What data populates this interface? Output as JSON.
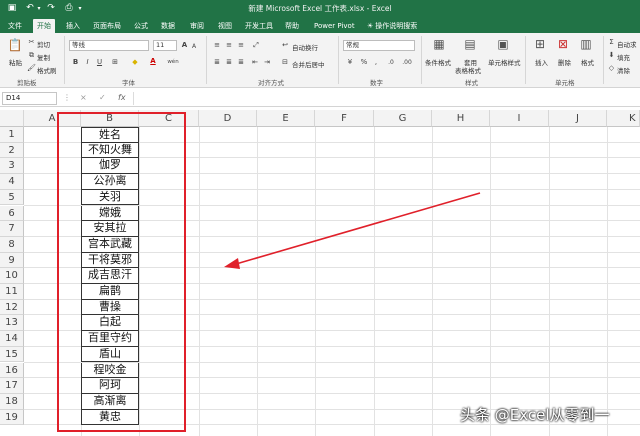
{
  "titlebar": {
    "title": "新建 Microsoft Excel 工作表.xlsx  -  Excel"
  },
  "tabs": [
    "文件",
    "开始",
    "插入",
    "页面布局",
    "公式",
    "数据",
    "审阅",
    "视图",
    "开发工具",
    "帮助",
    "Power Pivot",
    "操作说明搜索"
  ],
  "ribbon": {
    "clipboard": {
      "cut": "剪切",
      "copy": "复制",
      "format_painter": "格式刷",
      "paste": "粘贴",
      "label": "剪贴板"
    },
    "font": {
      "name": "等线",
      "size": "11",
      "bold": "B",
      "italic": "I",
      "underline": "U",
      "label": "字体",
      "font_color_glyph": "A",
      "grow": "A",
      "shrink": "A",
      "phonetic": "wén"
    },
    "alignment": {
      "wrap": "自动换行",
      "merge": "合并后居中",
      "label": "对齐方式"
    },
    "number": {
      "format": "常规",
      "label": "数字",
      "currency": "%",
      "comma": ",",
      "inc": ".0",
      "dec": ".00"
    },
    "styles": {
      "cond": "条件格式",
      "table": "套用",
      "table2": "表格格式",
      "cell": "单元格样式",
      "label": "样式"
    },
    "cells": {
      "insert": "插入",
      "delete": "删除",
      "format": "格式",
      "label": "单元格"
    },
    "editing": {
      "sum": "自动求",
      "fill": "填充",
      "clear": "清除"
    }
  },
  "formula_bar": {
    "name_box": "D14",
    "fx": "fx",
    "cancel": "×",
    "enter": "✓"
  },
  "columns": [
    "A",
    "B",
    "C",
    "D",
    "E",
    "F",
    "G",
    "H",
    "I",
    "J",
    "K"
  ],
  "rows": [
    "1",
    "2",
    "3",
    "4",
    "5",
    "6",
    "7",
    "8",
    "9",
    "10",
    "11",
    "12",
    "13",
    "14",
    "15",
    "16",
    "17",
    "18",
    "19"
  ],
  "cells_b": [
    "姓名",
    "不知火舞",
    "伽罗",
    "公孙离",
    "关羽",
    "嫦娥",
    "安其拉",
    "宫本武藏",
    "干将莫邪",
    "成吉思汗",
    "扁鹊",
    "曹操",
    "白起",
    "百里守约",
    "盾山",
    "程咬金",
    "阿珂",
    "高渐离",
    "黄忠"
  ],
  "watermark": "头条 @Excel从零到一",
  "colors": {
    "brand": "#217346",
    "highlight": "#e0202a"
  }
}
